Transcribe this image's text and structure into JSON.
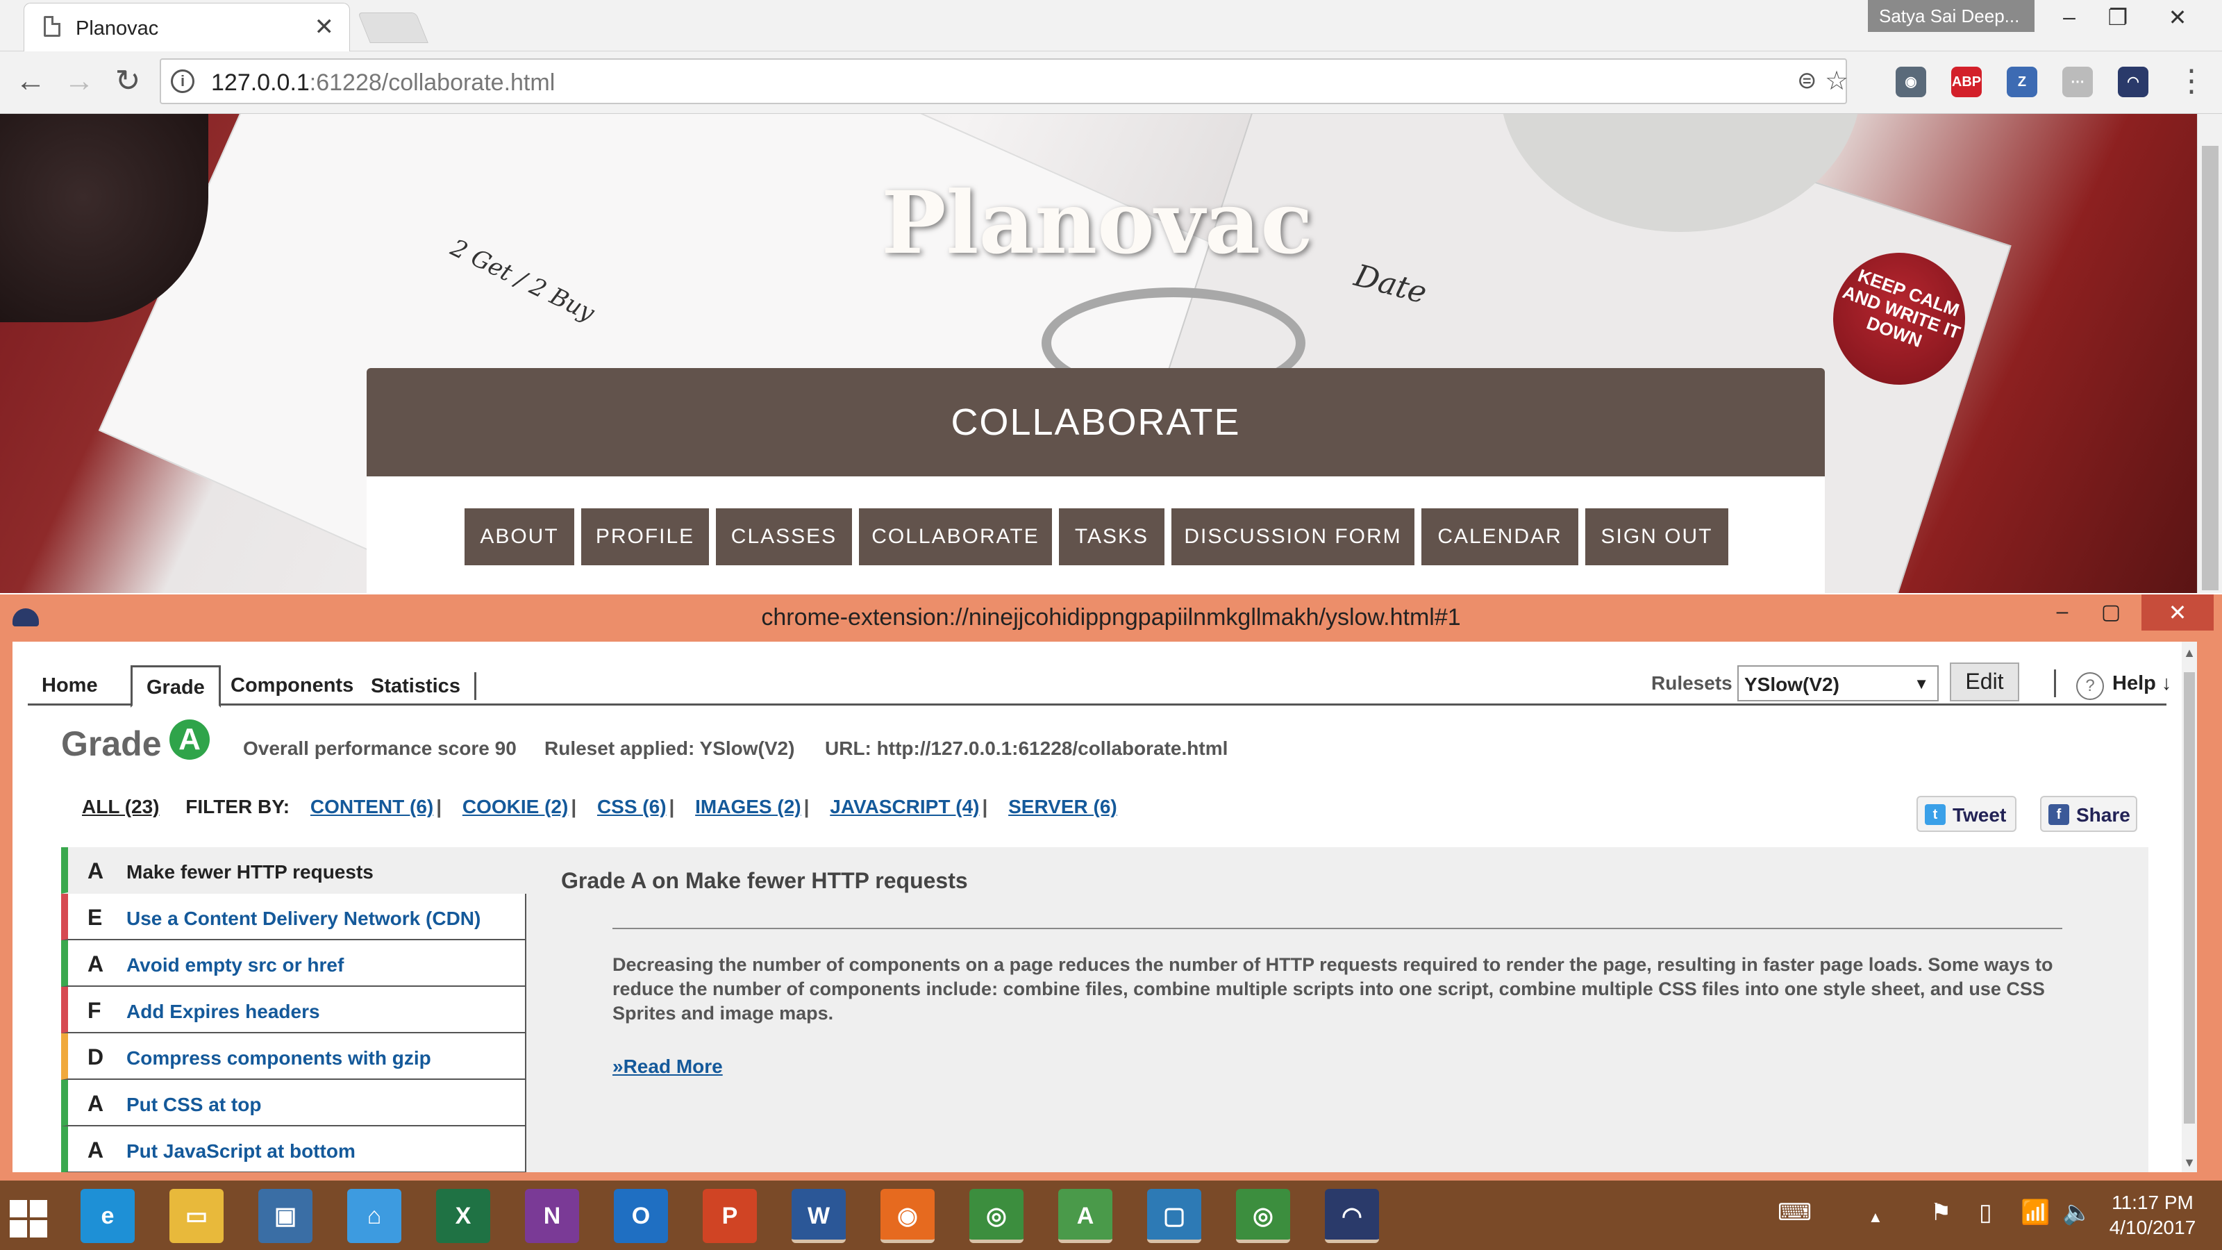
{
  "browser": {
    "tab_title": "Planovac",
    "tab_close": "✕",
    "profile_name": "Satya Sai Deep...",
    "window_controls": [
      "–",
      "❐",
      "✕"
    ],
    "url_host": "127.0.0.1",
    "url_rest": ":61228/collaborate.html",
    "nav_icons": [
      "back-arrow-icon",
      "forward-arrow-icon",
      "reload-icon",
      "info-icon",
      "translate-icon",
      "star-icon"
    ],
    "extensions": [
      {
        "name": "shield-extension-icon",
        "label": "◉",
        "color": "#5a6a7a"
      },
      {
        "name": "adblock-plus-icon",
        "label": "ABP",
        "color": "#d3202a"
      },
      {
        "name": "zotero-icon",
        "label": "Z",
        "color": "#3d6bb3"
      },
      {
        "name": "pending-extension-icon",
        "label": "⋯",
        "color": "#bbbbbb"
      },
      {
        "name": "yslow-extension-icon",
        "label": "◠",
        "color": "#2a3a6a"
      }
    ],
    "menu_glyph": "⋮"
  },
  "site": {
    "title": "Planovac",
    "section_title": "COLLABORATE",
    "date_label": "Date",
    "get_label": "2 Get / 2 Buy",
    "badge_text": "KEEP CALM AND WRITE IT DOWN",
    "nav": [
      "ABOUT",
      "PROFILE",
      "CLASSES",
      "COLLABORATE",
      "TASKS",
      "DISCUSSION FORM",
      "CALENDAR",
      "SIGN OUT"
    ]
  },
  "yslow": {
    "window_title": "chrome-extension://ninejjcohidippngpapiilnmkgllmakh/yslow.html#1",
    "window_controls": [
      "–",
      "▢",
      "✕"
    ],
    "tabs": [
      "Home",
      "Grade",
      "Components",
      "Statistics"
    ],
    "active_tab": "Grade",
    "rulesets_label": "Rulesets",
    "ruleset_value": "YSlow(V2)",
    "ruleset_arrow": "▼",
    "edit_label": "Edit",
    "help_icon": "?",
    "help_label": "Help ↓",
    "grade_word": "Grade",
    "grade_letter": "A",
    "overall_score": "Overall performance score 90",
    "ruleset_applied": "Ruleset applied: YSlow(V2)",
    "page_url": "URL: http://127.0.0.1:61228/collaborate.html",
    "filter_all": "ALL (23)",
    "filter_by": "FILTER BY:",
    "filters": [
      "CONTENT (6)",
      "COOKIE (2)",
      "CSS (6)",
      "IMAGES (2)",
      "JAVASCRIPT (4)",
      "SERVER (6)"
    ],
    "filter_separator": "|",
    "tweet_label": "Tweet",
    "share_label": "Share",
    "rules": [
      {
        "grade": "A",
        "name": "Make fewer HTTP requests",
        "status_color": "#3aa84e",
        "active": true
      },
      {
        "grade": "E",
        "name": "Use a Content Delivery Network (CDN)",
        "status_color": "#d64a52",
        "active": false
      },
      {
        "grade": "A",
        "name": "Avoid empty src or href",
        "status_color": "#3aa84e",
        "active": false
      },
      {
        "grade": "F",
        "name": "Add Expires headers",
        "status_color": "#d64a52",
        "active": false
      },
      {
        "grade": "D",
        "name": "Compress components with gzip",
        "status_color": "#f0a93c",
        "active": false
      },
      {
        "grade": "A",
        "name": "Put CSS at top",
        "status_color": "#3aa84e",
        "active": false
      },
      {
        "grade": "A",
        "name": "Put JavaScript at bottom",
        "status_color": "#3aa84e",
        "active": false
      }
    ],
    "detail_title": "Grade A on Make fewer HTTP requests",
    "detail_text": "Decreasing the number of components on a page reduces the number of HTTP requests required to render the page, resulting in faster page loads. Some ways to reduce the number of components include: combine files, combine multiple scripts into one script, combine multiple CSS files into one style sheet, and use CSS Sprites and image maps.",
    "read_more": "»Read More"
  },
  "taskbar": {
    "apps": [
      {
        "name": "internet-explorer-icon",
        "glyph": "e",
        "color": "#1e90d6"
      },
      {
        "name": "file-explorer-icon",
        "glyph": "▭",
        "color": "#e8b93b"
      },
      {
        "name": "lenovo-icon",
        "glyph": "▣",
        "color": "#3a6ea5"
      },
      {
        "name": "store-icon",
        "glyph": "⌂",
        "color": "#3d9be0"
      },
      {
        "name": "excel-icon",
        "glyph": "X",
        "color": "#1f7244"
      },
      {
        "name": "onenote-icon",
        "glyph": "N",
        "color": "#7a3a96"
      },
      {
        "name": "outlook-icon",
        "glyph": "O",
        "color": "#1f6fc2"
      },
      {
        "name": "powerpoint-icon",
        "glyph": "P",
        "color": "#d04424"
      },
      {
        "name": "word-icon",
        "glyph": "W",
        "color": "#2b5797"
      },
      {
        "name": "firefox-icon",
        "glyph": "◉",
        "color": "#e66a1f"
      },
      {
        "name": "chrome-icon",
        "glyph": "◎",
        "color": "#3c8e3e"
      },
      {
        "name": "android-studio-icon",
        "glyph": "A",
        "color": "#4a9a4a"
      },
      {
        "name": "code-app-icon",
        "glyph": "▢",
        "color": "#2d7ab5"
      },
      {
        "name": "chrome-icon-2",
        "glyph": "◎",
        "color": "#3c8e3e"
      },
      {
        "name": "yslow-taskbar-icon",
        "glyph": "◠",
        "color": "#2a3a6a"
      }
    ],
    "tray_icons": [
      "keyboard-icon",
      "show-hidden-icons-icon",
      "flag-icon",
      "battery-icon",
      "wifi-icon",
      "volume-icon"
    ],
    "tray_glyphs": [
      "⌨",
      "▲",
      "⚑",
      "▯",
      "📶",
      "🔈"
    ],
    "time": "11:17 PM",
    "date": "4/10/2017"
  }
}
